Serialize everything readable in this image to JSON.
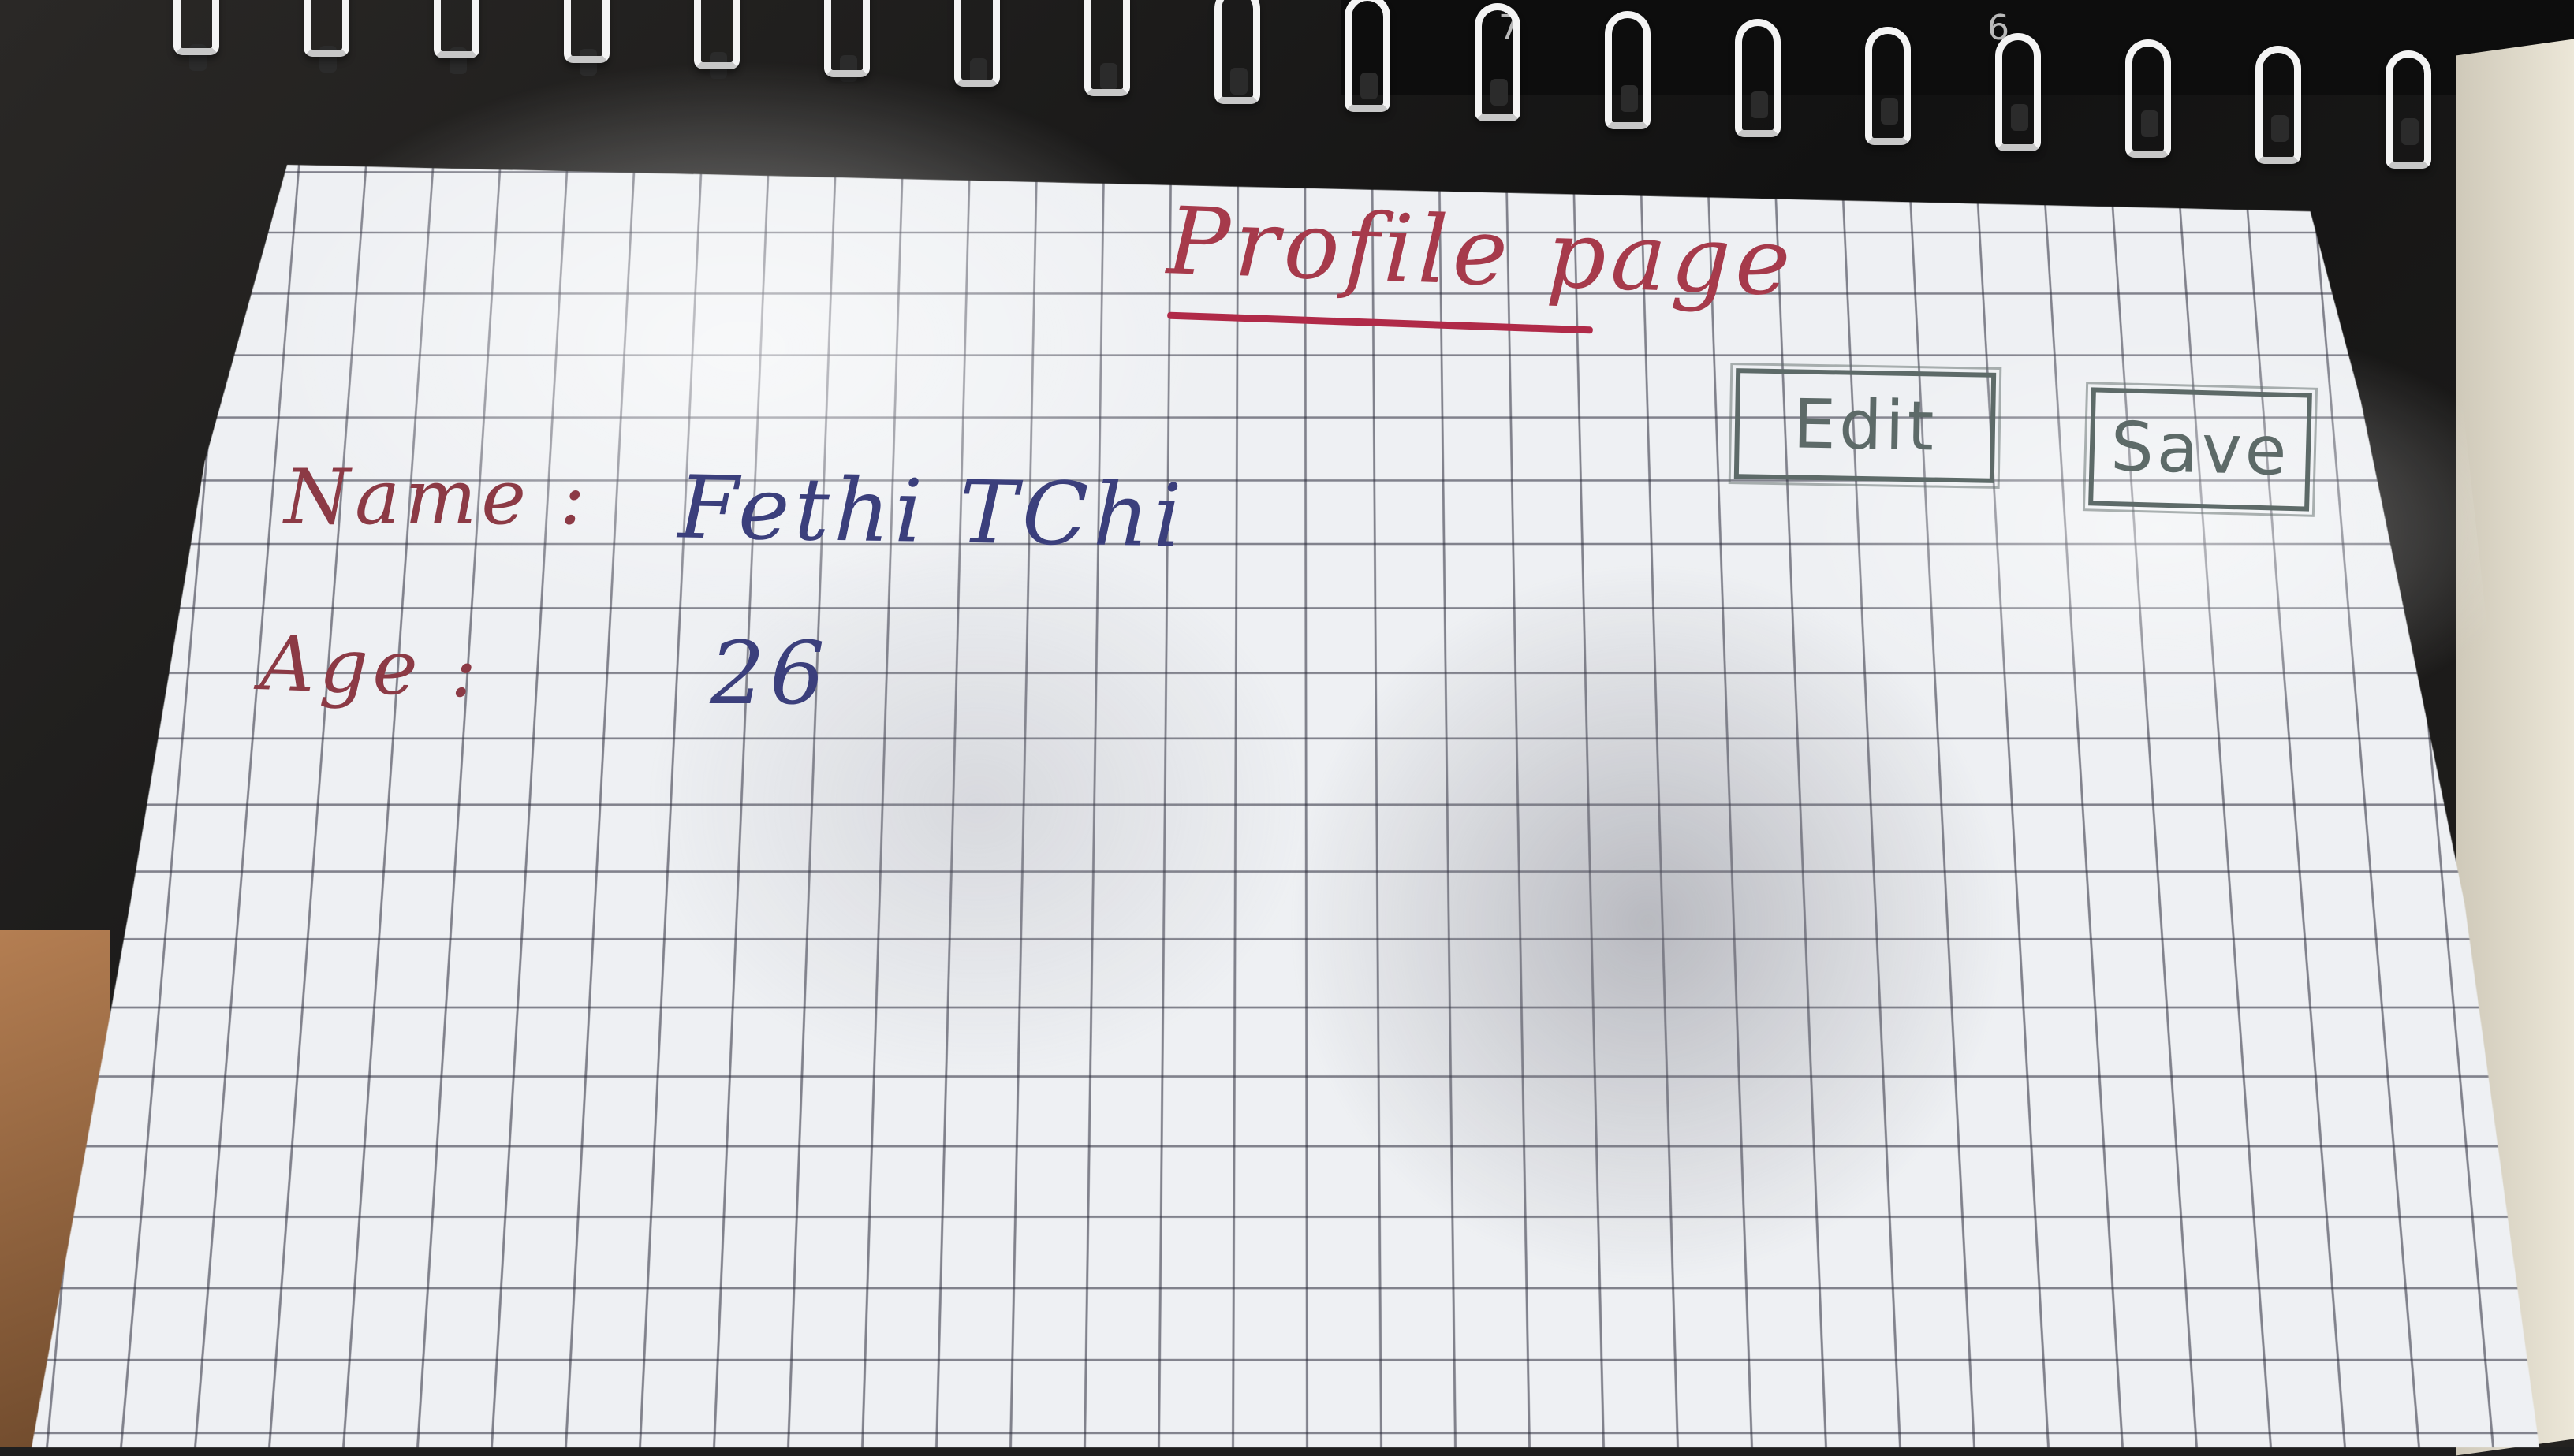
{
  "page": {
    "title": "Profile page",
    "name_label": "Name :",
    "name_value": "Fethi TChi",
    "age_label": "Age :",
    "age_value": "26"
  },
  "buttons": {
    "edit": "Edit",
    "save": "Save"
  },
  "keyboard": {
    "key_7": "7",
    "key_6": "6"
  },
  "colors": {
    "title_ink": "#a63a4b",
    "label_ink": "#8c3a45",
    "value_ink": "#3b3f7c",
    "button_ink": "#5d6a68",
    "paper": "#eef0f3"
  }
}
